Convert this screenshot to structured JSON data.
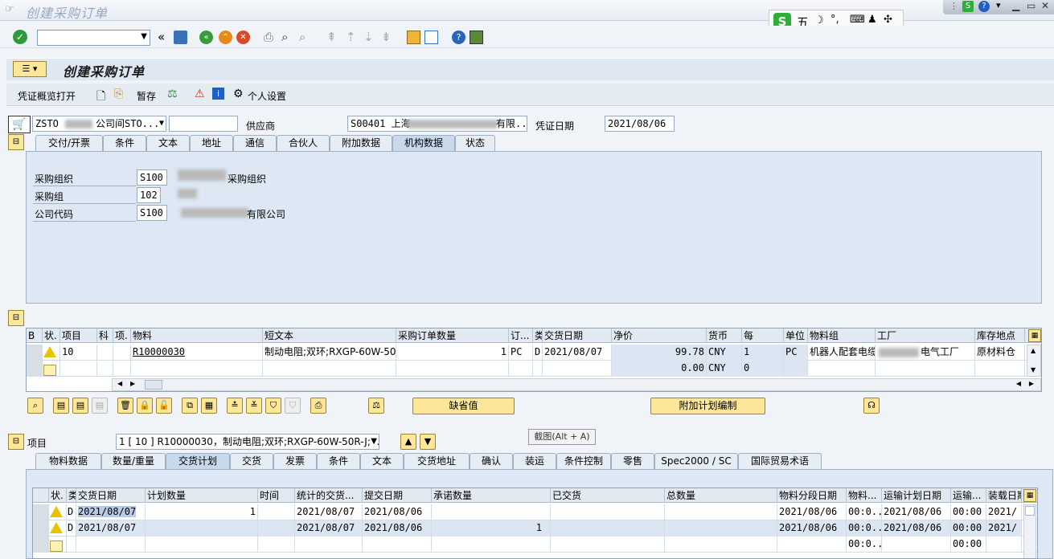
{
  "window": {
    "title": "创建采购订单"
  },
  "ime": {
    "mode": "五"
  },
  "header": {
    "title": "创建采购订单"
  },
  "appbar": {
    "doc_overview": "凭证概览打开",
    "hold": "暂存",
    "personal_settings": "个人设置"
  },
  "po_header": {
    "doc_type": "ZSTO",
    "doc_type_suffix": "公司间STO...",
    "vendor_label": "供应商",
    "vendor_value": "S00401 上海",
    "vendor_suffix": "有限...",
    "doc_date_label": "凭证日期",
    "doc_date": "2021/08/06"
  },
  "header_tabs": [
    "交付/开票",
    "条件",
    "文本",
    "地址",
    "通信",
    "合伙人",
    "附加数据",
    "机构数据",
    "状态"
  ],
  "org_data": {
    "purch_org_label": "采购组织",
    "purch_org": "S100",
    "purch_org_desc": "采购组织",
    "purch_group_label": "采购组",
    "purch_group": "102",
    "company_code_label": "公司代码",
    "company_code": "S100",
    "company_code_desc": "有限公司"
  },
  "items_grid": {
    "columns": [
      "B",
      "状.",
      "项目",
      "科",
      "项.",
      "物料",
      "短文本",
      "采购订单数量",
      "订...",
      "类",
      "交货日期",
      "净价",
      "货币",
      "每",
      "单位",
      "物料组",
      "工厂",
      "库存地点"
    ],
    "rows": [
      {
        "item": "10",
        "material": "R10000030",
        "short_text": "制动电阻;双环;RXGP-60W-50...",
        "qty": "1",
        "oun": "PC",
        "cat": "D",
        "delivery_date": "2021/08/07",
        "net_price": "99.78",
        "currency": "CNY",
        "per": "1",
        "unit": "PC",
        "mat_group": "机器人配套电缆",
        "plant": "电气工厂",
        "sloc": "原材料仓"
      },
      {
        "net_price": "0.00",
        "currency": "CNY",
        "per": "0"
      }
    ]
  },
  "item_buttons": {
    "default_values": "缺省值",
    "addl_planning": "附加计划编制"
  },
  "item_detail": {
    "label": "项目",
    "selected": "1 [ 10 ] R10000030，制动电阻;双环;RXGP-60W-50R-J;...",
    "tooltip": "截图(Alt + A)"
  },
  "item_tabs": [
    "物料数据",
    "数量/重量",
    "交货计划",
    "交货",
    "发票",
    "条件",
    "文本",
    "交货地址",
    "确认",
    "装运",
    "条件控制",
    "零售",
    "Spec2000 / SC",
    "国际贸易术语"
  ],
  "schedule_grid": {
    "columns": [
      "状.",
      "类",
      "交货日期",
      "计划数量",
      "时间",
      "统计的交货...",
      "提交日期",
      "承诺数量",
      "已交货",
      "总数量",
      "物料分段日期",
      "物料...",
      "运输计划日期",
      "运输...",
      "装载日期"
    ],
    "rows": [
      {
        "cat": "D",
        "delivery_date": "2021/08/07",
        "sched_qty": "1",
        "stat_date": "2021/08/07",
        "gr_date": "2021/08/06",
        "committed": "",
        "mat_date": "2021/08/06",
        "mat_time": "00:0...",
        "trans_date": "2021/08/06",
        "trans_time": "00:00",
        "load_date": "2021/"
      },
      {
        "cat": "D",
        "delivery_date": "2021/08/07",
        "sched_qty": "",
        "stat_date": "2021/08/07",
        "gr_date": "2021/08/06",
        "committed": "1",
        "mat_date": "2021/08/06",
        "mat_time": "00:0...",
        "trans_date": "2021/08/06",
        "trans_time": "00:00",
        "load_date": "2021/"
      },
      {
        "mat_time": "00:0...",
        "trans_time": "00:00"
      }
    ]
  }
}
